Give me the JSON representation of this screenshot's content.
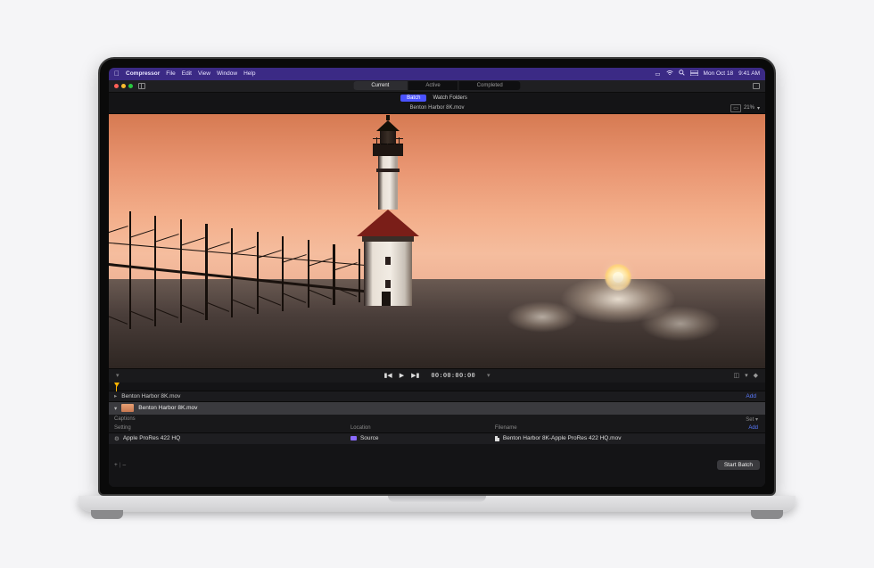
{
  "menubar": {
    "app": "Compressor",
    "items": [
      "File",
      "Edit",
      "View",
      "Window",
      "Help"
    ],
    "date": "Mon Oct 18",
    "time": "9:41 AM"
  },
  "toolbar": {
    "tabs": {
      "current": "Current",
      "active": "Active",
      "completed": "Completed"
    }
  },
  "subtabs": {
    "batch": "Batch",
    "watch": "Watch Folders"
  },
  "title": {
    "filename": "Benton Harbor 8K.mov",
    "zoom": "21%"
  },
  "playback": {
    "timecode": "00:00:00:00"
  },
  "job": {
    "header": "Benton Harbor 8K.mov",
    "add": "Add",
    "clip": "Benton Harbor 8K.mov"
  },
  "captions": {
    "label": "Captions",
    "set": "Set"
  },
  "columns": {
    "setting": "Setting",
    "location": "Location",
    "filename": "Filename",
    "add": "Add"
  },
  "row": {
    "setting": "Apple ProRes 422 HQ",
    "location": "Source",
    "output": "Benton Harbor 8K-Apple ProRes 422 HQ.mov"
  },
  "footer": {
    "plus": "+",
    "minus": "–",
    "start": "Start Batch"
  }
}
